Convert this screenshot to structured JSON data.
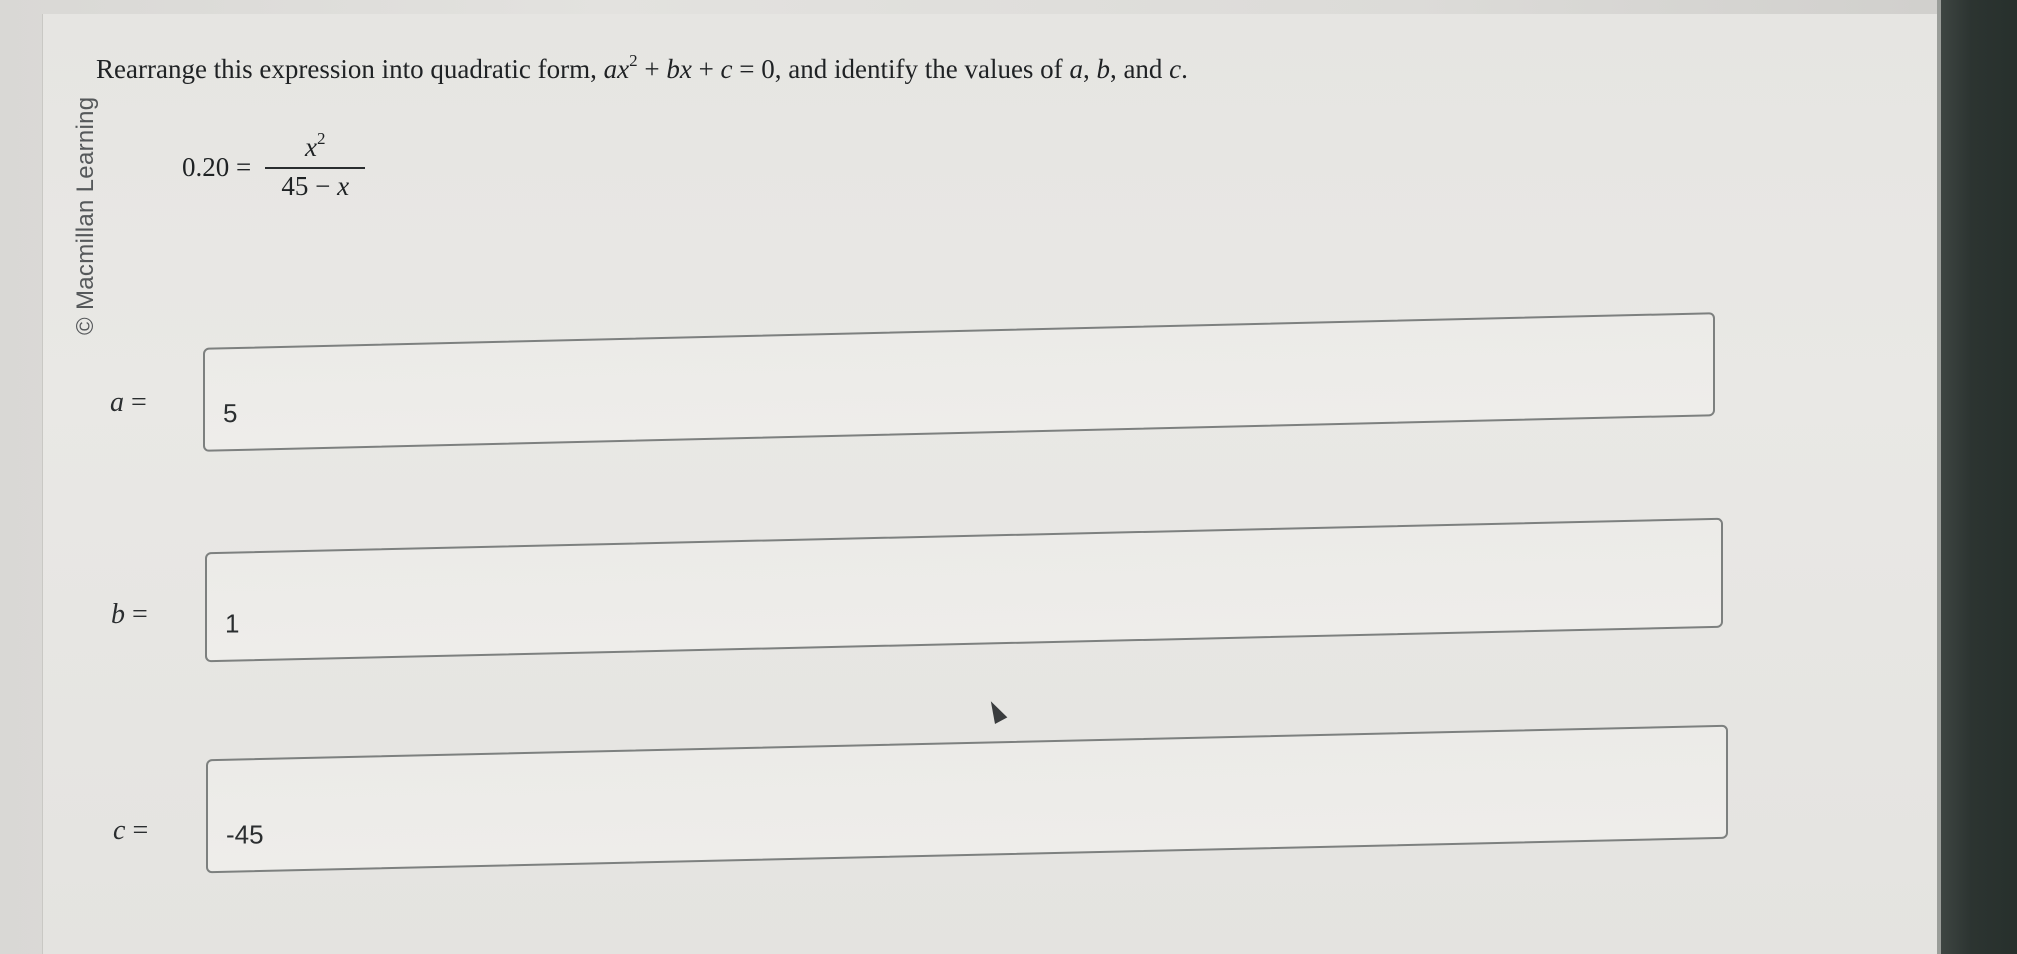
{
  "watermark": "© Macmillan Learning",
  "question": {
    "prefix": "Rearrange this expression into quadratic form, ",
    "formula_a": "ax",
    "formula_exp": "2",
    "formula_rest_1": " + ",
    "formula_b": "bx",
    "formula_rest_2": " + ",
    "formula_c": "c",
    "formula_rest_3": " = 0, and identify the values of ",
    "var_a": "a",
    "sep1": ", ",
    "var_b": "b",
    "sep2": ", and ",
    "var_c": "c",
    "end": "."
  },
  "equation": {
    "lhs": "0.20 =",
    "numerator_var": "x",
    "numerator_exp": "2",
    "denominator_num": "45 − ",
    "denominator_var": "x"
  },
  "fields": [
    {
      "var": "a",
      "label_suffix": " =",
      "value": "5"
    },
    {
      "var": "b",
      "label_suffix": " =",
      "value": "1"
    },
    {
      "var": "c",
      "label_suffix": " =",
      "value": "-45"
    }
  ]
}
